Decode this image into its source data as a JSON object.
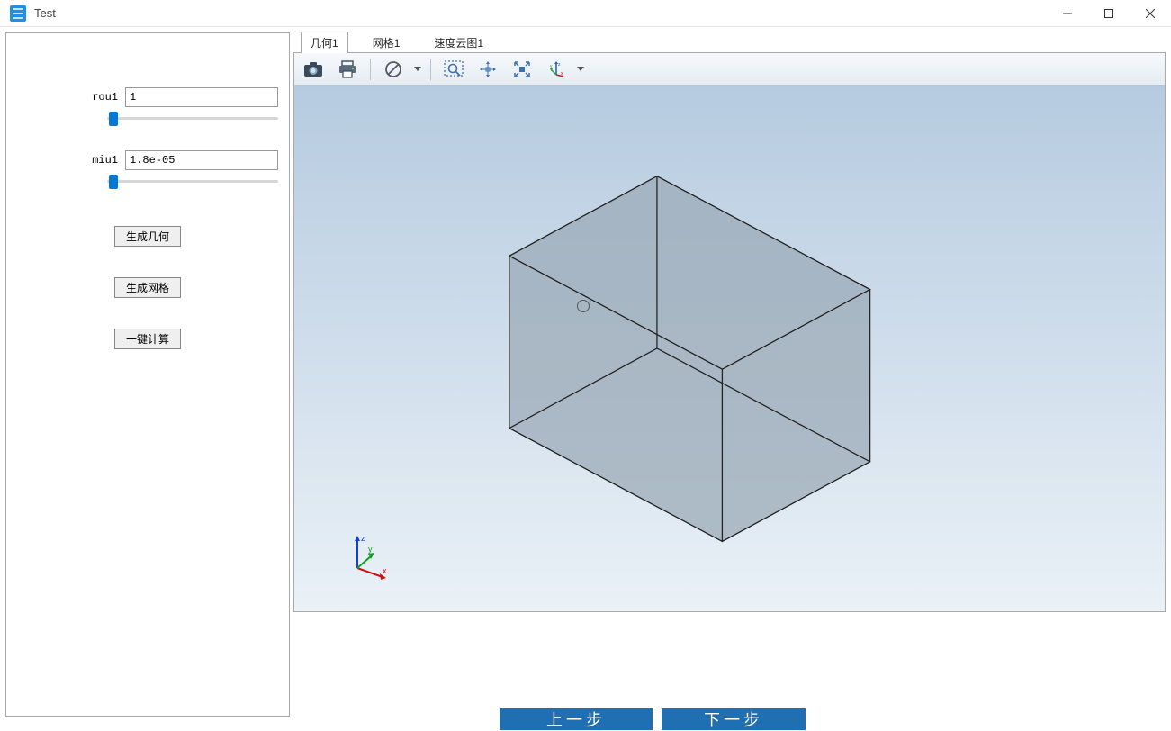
{
  "window": {
    "title": "Test"
  },
  "params": {
    "rou_label": "rou1",
    "rou_value": "1",
    "miu_label": "miu1",
    "miu_value": "1.8e-05"
  },
  "buttons": {
    "gen_geom": "生成几何",
    "gen_mesh": "生成网格",
    "one_click": "一键计算"
  },
  "tabs": {
    "items": [
      {
        "label": "几何1",
        "active": true
      },
      {
        "label": "网格1",
        "active": false
      },
      {
        "label": "速度云图1",
        "active": false
      }
    ]
  },
  "axes": {
    "x": "x",
    "y": "y",
    "z": "z"
  },
  "bottom": {
    "seg1": "上一步",
    "seg2": "下一步"
  }
}
